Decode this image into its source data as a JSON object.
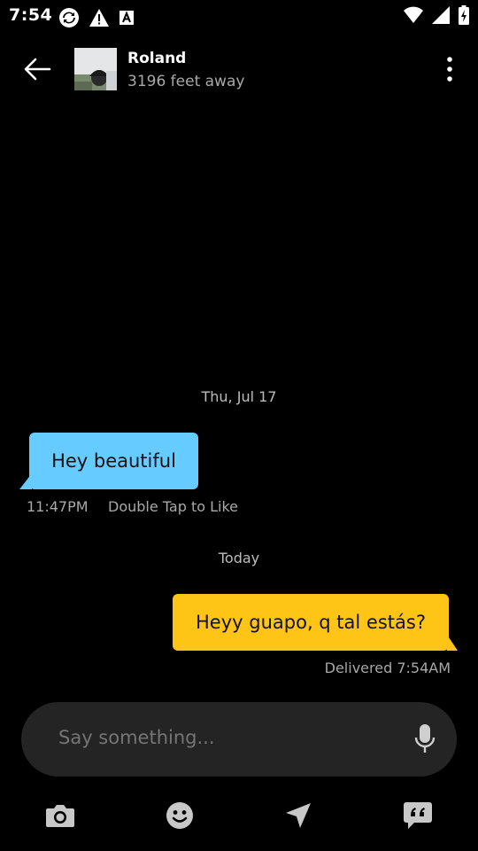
{
  "status_bar": {
    "time": "7:54"
  },
  "header": {
    "name": "Roland",
    "distance": "3196 feet away"
  },
  "messages": {
    "date_1": "Thu, Jul 17",
    "incoming_text": "Hey beautiful",
    "incoming_time": "11:47PM",
    "incoming_hint": "Double Tap to Like",
    "date_2": "Today",
    "outgoing_text": "Heyy guapo, q tal estás?",
    "outgoing_status": "Delivered 7:54AM"
  },
  "composer": {
    "placeholder": "Say something..."
  },
  "colors": {
    "incoming_bubble": "#66ccff",
    "outgoing_bubble": "#ffc516",
    "background": "#000000"
  }
}
